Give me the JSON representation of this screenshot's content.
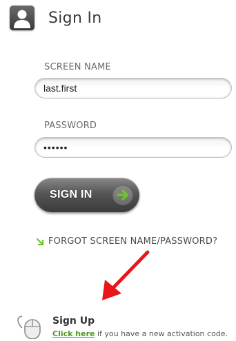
{
  "header": {
    "title": "Sign In",
    "icon": "user-silhouette-icon"
  },
  "form": {
    "screen_name_label": "SCREEN NAME",
    "screen_name_value": "last.first",
    "password_label": "PASSWORD",
    "password_value": "••••••",
    "signin_button_label": "SIGN IN",
    "signin_arrow_icon": "arrow-right-icon"
  },
  "forgot": {
    "label": "FORGOT SCREEN NAME/PASSWORD?",
    "bullet_icon": "green-bullet-icon"
  },
  "signup": {
    "title": "Sign Up",
    "link_text": "Click here",
    "tail_text": " if you have a new activation code.",
    "icon": "mouse-icon"
  },
  "colors": {
    "accent_green": "#6cc42a",
    "link_green": "#4c9a1e",
    "arrow_red": "#e8151b",
    "button_dark": "#3b3b3b"
  }
}
